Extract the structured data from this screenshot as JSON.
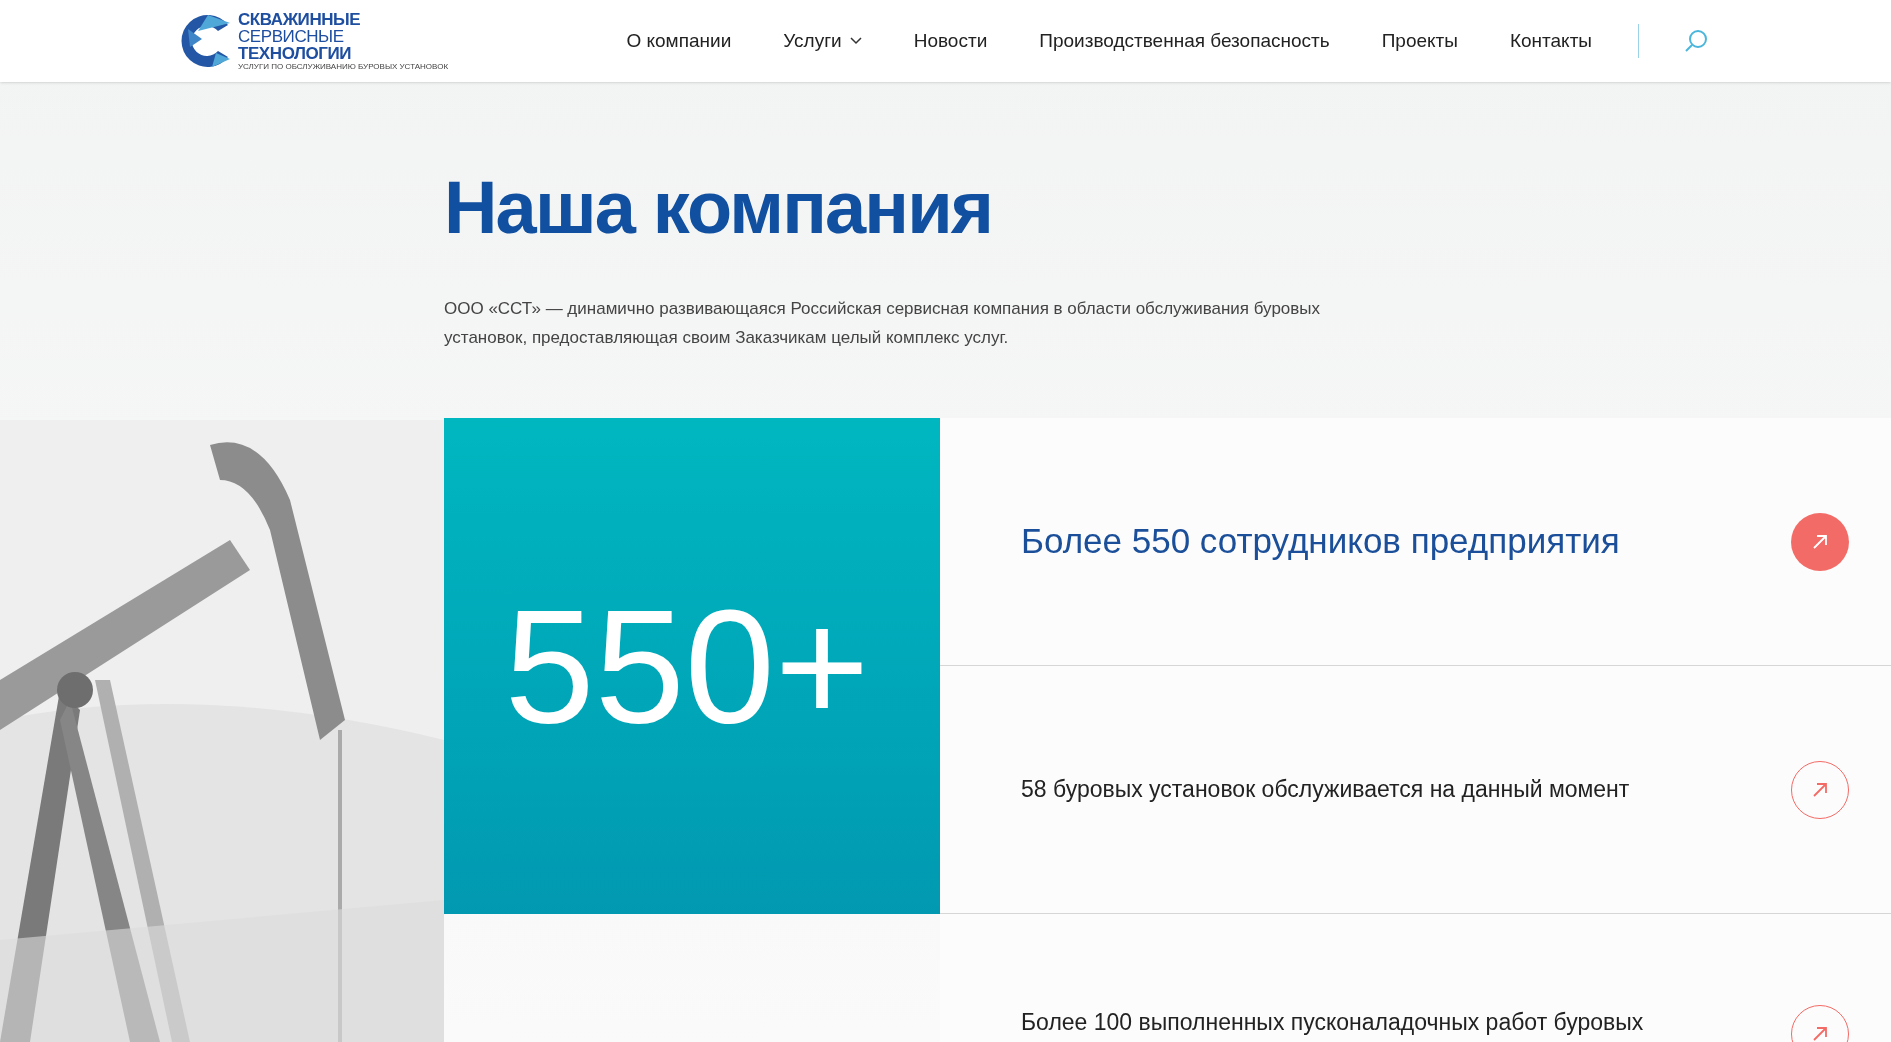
{
  "logo": {
    "lines": [
      "СКВАЖИННЫЕ",
      "СЕРВИСНЫЕ",
      "ТЕХНОЛОГИИ"
    ],
    "tagline": "УСЛУГИ ПО ОБСЛУЖИВАНИЮ БУРОВЫХ УСТАНОВОК"
  },
  "nav": [
    {
      "label": "О компании",
      "dropdown": false
    },
    {
      "label": "Услуги",
      "dropdown": true
    },
    {
      "label": "Новости",
      "dropdown": false
    },
    {
      "label": "Производственная безопасность",
      "dropdown": false
    },
    {
      "label": "Проекты",
      "dropdown": false
    },
    {
      "label": "Контакты",
      "dropdown": false
    }
  ],
  "title": "Наша компания",
  "intro": "ООО «ССТ» — динамично развивающаяся Российская сервисная компания в области обслуживания буровых установок, предоставляющая своим Заказчикам целый комплекс услуг.",
  "stat": "550+",
  "facts": [
    {
      "text": "Более 550 сотрудников предприятия",
      "selected": true
    },
    {
      "text": "58 буровых установок обслуживается на данный момент",
      "selected": false
    },
    {
      "text": "Более 100 выполненных пусконаладочных работ буровых",
      "selected": false
    }
  ]
}
